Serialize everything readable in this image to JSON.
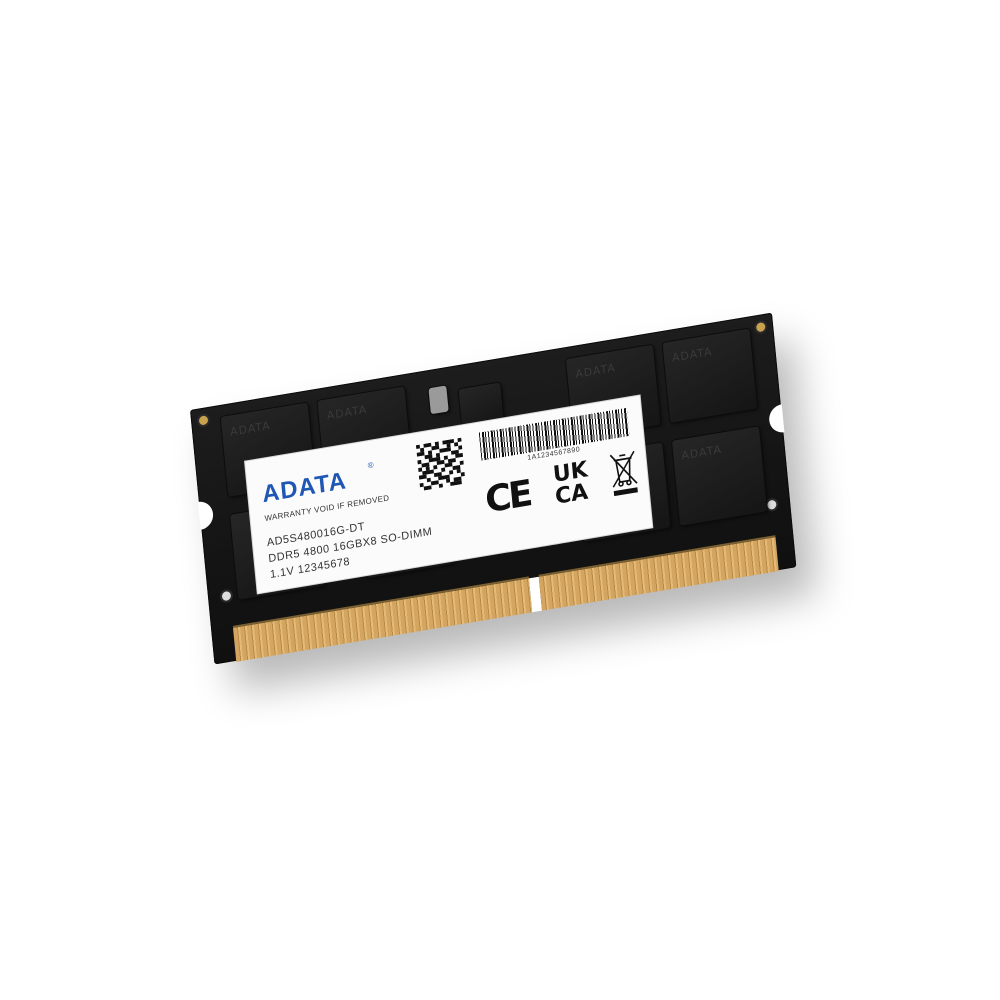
{
  "product": {
    "brand": "ADATA",
    "brand_reg": "®",
    "warranty": "WARRANTY VOID IF REMOVED",
    "part_number": "AD5S480016G-DT",
    "spec_line": "DDR5  4800  16GBX8  SO-DIMM",
    "voltage_line": "1.1V   12345678",
    "barcode_number": "1A1234567890",
    "ce_mark": "CE",
    "ukca_mark": "UK CA"
  },
  "colors": {
    "brand_blue": "#1e57b4",
    "pcb": "#141414",
    "gold_contacts": "#d4a561",
    "background": "#ffffff"
  },
  "icons": [
    "qr-code-icon",
    "barcode-icon",
    "ce-mark-icon",
    "ukca-mark-icon",
    "weee-bin-icon"
  ]
}
